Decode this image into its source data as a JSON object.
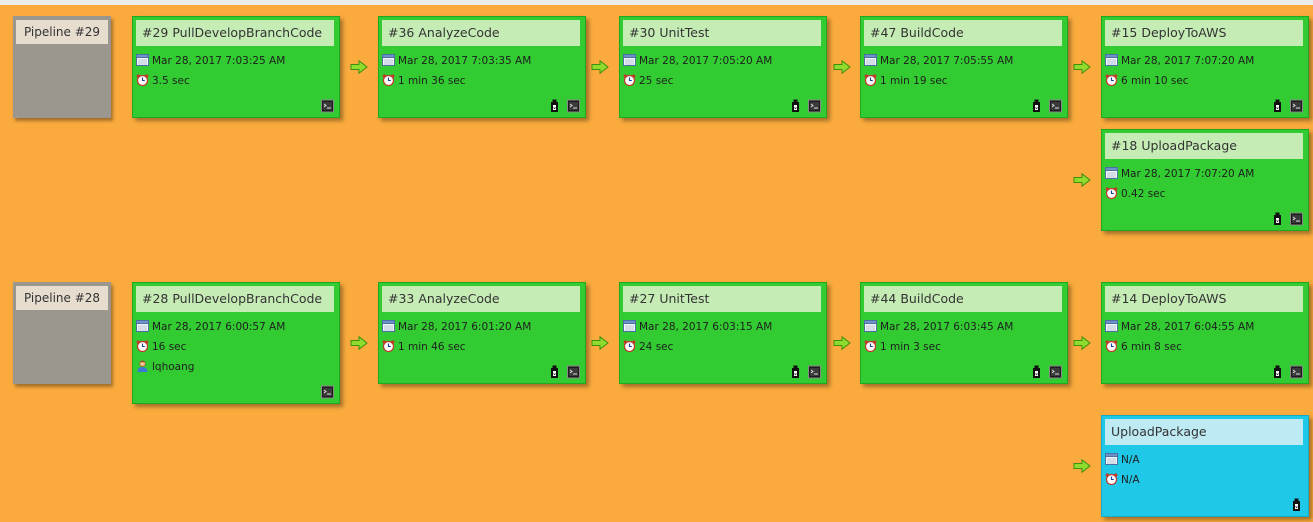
{
  "colors": {
    "background": "#fbab3d",
    "success_card": "#32cc32",
    "pending_card": "#1ec8e6",
    "pipeline_box": "#9c978e"
  },
  "icons": {
    "calendar": "calendar-icon",
    "duration": "alarm-clock-icon",
    "user": "user-icon",
    "console": "console-icon",
    "artifact": "artifact-icon",
    "arrow": "green-arrow-icon"
  },
  "pipelines": [
    {
      "label": "Pipeline #29",
      "jobs": [
        {
          "title": "#29 PullDevelopBranchCode",
          "date": "Mar 28, 2017 7:03:25 AM",
          "duration": "3.5 sec",
          "status": "success"
        },
        {
          "title": "#36 AnalyzeCode",
          "date": "Mar 28, 2017 7:03:35 AM",
          "duration": "1 min 36 sec",
          "status": "success"
        },
        {
          "title": "#30 UnitTest",
          "date": "Mar 28, 2017 7:05:20 AM",
          "duration": "25 sec",
          "status": "success"
        },
        {
          "title": "#47 BuildCode",
          "date": "Mar 28, 2017 7:05:55 AM",
          "duration": "1 min 19 sec",
          "status": "success"
        },
        {
          "title": "#15 DeployToAWS",
          "date": "Mar 28, 2017 7:07:20 AM",
          "duration": "6 min 10 sec",
          "status": "success"
        },
        {
          "title": "#18 UploadPackage",
          "date": "Mar 28, 2017 7:07:20 AM",
          "duration": "0.42 sec",
          "status": "success"
        }
      ]
    },
    {
      "label": "Pipeline #28",
      "jobs": [
        {
          "title": "#28 PullDevelopBranchCode",
          "date": "Mar 28, 2017 6:00:57 AM",
          "duration": "16 sec",
          "user": "lqhoang",
          "status": "success"
        },
        {
          "title": "#33 AnalyzeCode",
          "date": "Mar 28, 2017 6:01:20 AM",
          "duration": "1 min 46 sec",
          "status": "success"
        },
        {
          "title": "#27 UnitTest",
          "date": "Mar 28, 2017 6:03:15 AM",
          "duration": "24 sec",
          "status": "success"
        },
        {
          "title": "#44 BuildCode",
          "date": "Mar 28, 2017 6:03:45 AM",
          "duration": "1 min 3 sec",
          "status": "success"
        },
        {
          "title": "#14 DeployToAWS",
          "date": "Mar 28, 2017 6:04:55 AM",
          "duration": "6 min 8 sec",
          "status": "success"
        },
        {
          "title": "UploadPackage",
          "date": "N/A",
          "duration": "N/A",
          "status": "pending"
        }
      ]
    }
  ]
}
